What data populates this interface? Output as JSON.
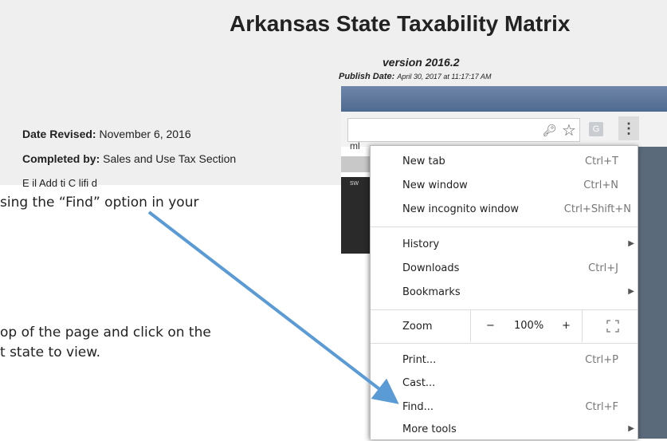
{
  "document": {
    "title": "Arkansas State Taxability Matrix",
    "version": "version 2016.2",
    "publish_label": "Publish Date:",
    "publish_value": "April 30, 2017 at 11:17:17 AM",
    "date_revised_label": "Date Revised:",
    "date_revised_value": "November 6, 2016",
    "completed_by_label": "Completed by:",
    "completed_by_value": "Sales and Use Tax Section",
    "cut_line": "E     il Add        ti   C lifi  d"
  },
  "instructions": {
    "line1": "sing the “Find” option in your",
    "line2": "op of the page and click on the",
    "line3": "t state to view."
  },
  "browser": {
    "extension_letter": "G",
    "page_strip_text": "ml",
    "page_strip_text2": "sw",
    "menu_button": "⋮"
  },
  "menu": {
    "items": [
      {
        "label": "New tab",
        "shortcut": "Ctrl+T"
      },
      {
        "label": "New window",
        "shortcut": "Ctrl+N"
      },
      {
        "label": "New incognito window",
        "shortcut": "Ctrl+Shift+N"
      },
      {
        "label": "History",
        "shortcut": ""
      },
      {
        "label": "Downloads",
        "shortcut": "Ctrl+J"
      },
      {
        "label": "Bookmarks",
        "shortcut": ""
      },
      {
        "label": "Zoom",
        "shortcut": ""
      },
      {
        "label": "Print...",
        "shortcut": "Ctrl+P"
      },
      {
        "label": "Cast...",
        "shortcut": ""
      },
      {
        "label": "Find...",
        "shortcut": "Ctrl+F"
      },
      {
        "label": "More tools",
        "shortcut": ""
      }
    ],
    "zoom": {
      "minus": "−",
      "value": "100%",
      "plus": "+"
    }
  },
  "colors": {
    "arrow": "#5b9bd5",
    "document_bg": "#efefef"
  }
}
